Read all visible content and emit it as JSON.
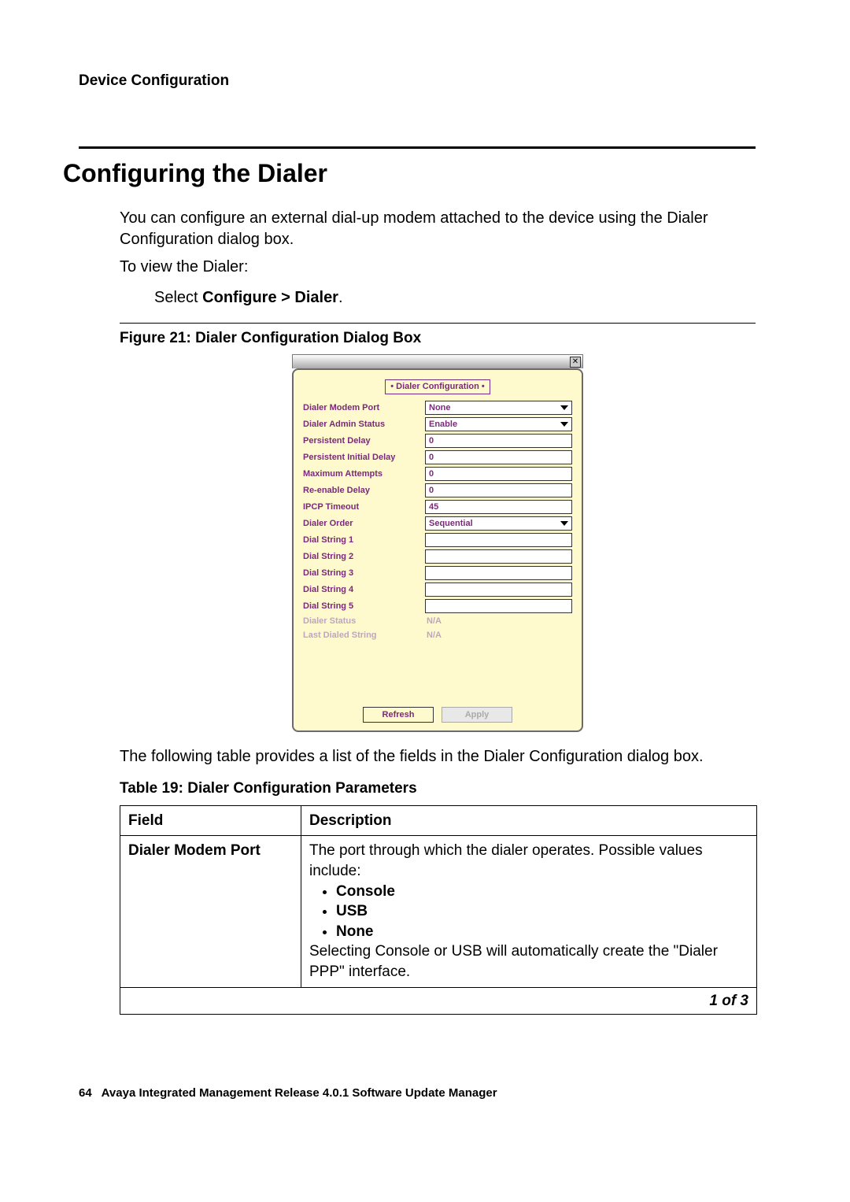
{
  "header": {
    "breadcrumb": "Device Configuration"
  },
  "page": {
    "title": "Configuring the Dialer",
    "intro": "You can configure an external dial-up modem attached to the device using the Dialer Configuration dialog box.",
    "to_view": "To view the Dialer:",
    "step_prefix": "Select ",
    "step_path": "Configure > Dialer",
    "step_suffix": ".",
    "figure_caption": "Figure 21: Dialer Configuration Dialog Box",
    "table_intro": "The following table provides a list of the fields in the Dialer Configuration dialog box.",
    "table_title": "Table 19: Dialer Configuration Parameters"
  },
  "dialog": {
    "tab_title": "• Dialer Configuration •",
    "close_glyph": "✕",
    "fields": {
      "modem_port": {
        "label": "Dialer Modem Port",
        "value": "None"
      },
      "admin_status": {
        "label": "Dialer Admin Status",
        "value": "Enable"
      },
      "persistent_delay": {
        "label": "Persistent Delay",
        "value": "0"
      },
      "persistent_initial": {
        "label": "Persistent Initial Delay",
        "value": "0"
      },
      "max_attempts": {
        "label": "Maximum Attempts",
        "value": "0"
      },
      "reenable_delay": {
        "label": "Re-enable Delay",
        "value": "0"
      },
      "ipcp_timeout": {
        "label": "IPCP Timeout",
        "value": "45"
      },
      "dialer_order": {
        "label": "Dialer Order",
        "value": "Sequential"
      },
      "ds1": {
        "label": "Dial String 1",
        "value": ""
      },
      "ds2": {
        "label": "Dial String 2",
        "value": ""
      },
      "ds3": {
        "label": "Dial String 3",
        "value": ""
      },
      "ds4": {
        "label": "Dial String 4",
        "value": ""
      },
      "ds5": {
        "label": "Dial String 5",
        "value": ""
      },
      "dialer_status": {
        "label": "Dialer Status",
        "value": "N/A"
      },
      "last_dialed": {
        "label": "Last Dialed String",
        "value": "N/A"
      }
    },
    "buttons": {
      "refresh": "Refresh",
      "apply": "Apply"
    }
  },
  "table": {
    "head_field": "Field",
    "head_desc": "Description",
    "rows": [
      {
        "field": "Dialer Modem Port",
        "desc_pre": "The port through which the dialer operates. Possible values include:",
        "bullets": [
          "Console",
          "USB",
          "None"
        ],
        "desc_post": "Selecting Console or USB will automatically create the \"Dialer PPP\" interface."
      }
    ],
    "pager": "1 of 3"
  },
  "footer": {
    "page_num": "64",
    "doc_title": "Avaya Integrated Management Release 4.0.1 Software Update Manager"
  }
}
